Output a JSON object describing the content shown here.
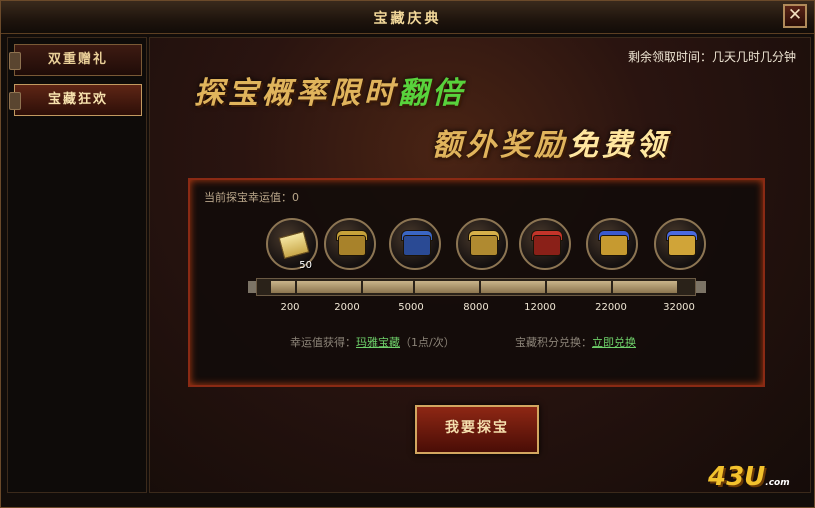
{
  "window": {
    "title": "宝藏庆典",
    "close_glyph": "✕"
  },
  "sidebar": {
    "items": [
      {
        "label": "双重赠礼",
        "active": false
      },
      {
        "label": "宝藏狂欢",
        "active": true
      }
    ]
  },
  "header": {
    "remaining_time": "剩余领取时间：几天几时几分钟"
  },
  "slogan": {
    "line1_main": "探宝概率限时",
    "line1_highlight": "翻倍",
    "line2_main": "额外奖励",
    "line2_highlight": "免费领"
  },
  "panel": {
    "current_luck": "当前探宝幸运值：0",
    "reward_item_count": "50",
    "milestones": [
      "200",
      "2000",
      "5000",
      "8000",
      "12000",
      "22000",
      "32000"
    ],
    "chest_icons": [
      "scroll-icon",
      "gold-chest-icon",
      "blue-chest-icon",
      "gold-chest-icon",
      "red-chest-icon",
      "blue-gold-chest-icon",
      "blue-gold-chest-icon"
    ],
    "progress": 0,
    "gain_label": "幸运值获得：",
    "gain_link": "玛雅宝藏",
    "gain_rate": "（1点/次）",
    "exchange_label": "宝藏积分兑换：",
    "exchange_link": "立即兑换"
  },
  "action": {
    "explore_button": "我要探宝"
  },
  "watermark": {
    "logo_text": "43U",
    "logo_suffix": ".com"
  },
  "colors": {
    "accent": "#e0b45c",
    "highlight_green": "#58d23c",
    "link": "#6ed06a",
    "panel_border": "#8a2a14"
  }
}
